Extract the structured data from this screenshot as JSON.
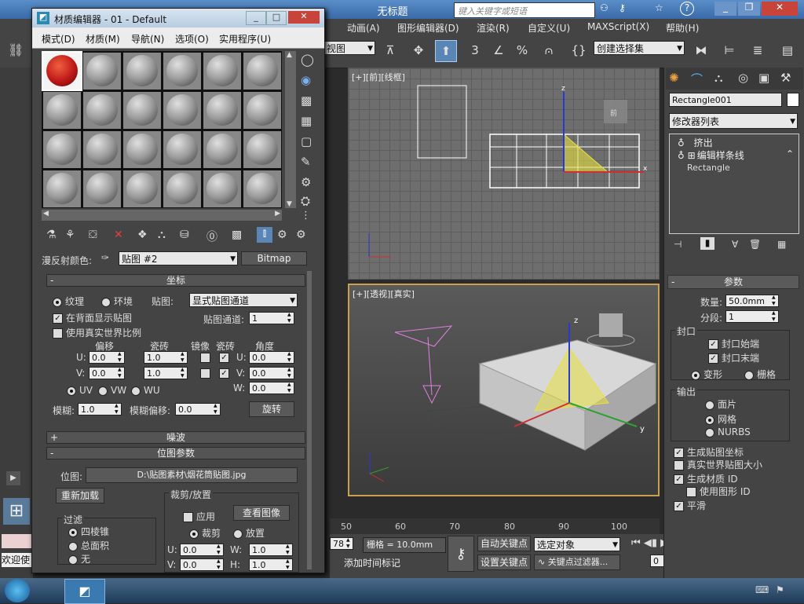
{
  "main": {
    "title": "无标题",
    "search_placeholder": "键入关键字或短语",
    "menu": [
      "动画(A)",
      "图形编辑器(D)",
      "渲染(R)",
      "自定义(U)",
      "MAXScript(X)",
      "帮助(H)"
    ],
    "view_dropdown": "视图",
    "selection_set_placeholder": "创建选择集",
    "vp_front_label": "[+][前][线框]",
    "vp_persp_label": "[+][透视][真实]",
    "ruler_ticks": [
      "50",
      "60",
      "70",
      "80",
      "90",
      "100"
    ],
    "frame_field": "78",
    "grid_status": "栅格 = 10.0mm",
    "auto_key": "自动关键点",
    "set_key": "设置关键点",
    "key_filter_select": "选定对象",
    "add_time_tag": "添加时间标记",
    "key_filters": "关键点过滤器...",
    "frame_current": "0",
    "welcome_text": "欢迎使"
  },
  "cmd": {
    "object_name": "Rectangle001",
    "modifier_list": "修改器列表",
    "stack": [
      "挤出",
      "编辑样条线",
      "Rectangle"
    ],
    "params_title": "参数",
    "amount_label": "数量:",
    "amount_value": "50.0mm",
    "segments_label": "分段:",
    "segments_value": "1",
    "capping_title": "封口",
    "cap_start": "封口始端",
    "cap_end": "封口末端",
    "morph": "变形",
    "grid": "栅格",
    "output_title": "输出",
    "out_patch": "面片",
    "out_mesh": "网格",
    "out_nurbs": "NURBS",
    "gen_mapping": "生成贴图坐标",
    "real_world": "真实世界贴图大小",
    "gen_mat_id": "生成材质 ID",
    "use_shape_id": "使用图形 ID",
    "smooth": "平滑"
  },
  "mat": {
    "title": "材质编辑器 - 01 - Default",
    "menu": [
      "模式(D)",
      "材质(M)",
      "导航(N)",
      "选项(O)",
      "实用程序(U)"
    ],
    "diffuse_label": "漫反射颜色:",
    "map_name": "贴图 #2",
    "map_type": "Bitmap",
    "coords_title": "坐标",
    "texture": "纹理",
    "environ": "环境",
    "mapping_label": "贴图:",
    "mapping_value": "显式贴图通道",
    "show_back": "在背面显示贴图",
    "map_channel_label": "贴图通道:",
    "map_channel_value": "1",
    "use_real_world": "使用真实世界比例",
    "col_offset": "偏移",
    "col_tiling": "瓷砖",
    "col_mirror": "镜像",
    "col_tile": "瓷砖",
    "col_angle": "角度",
    "u_label": "U:",
    "v_label": "V:",
    "w_label": "W:",
    "u_offset": "0.0",
    "v_offset": "0.0",
    "u_tiling": "1.0",
    "v_tiling": "1.0",
    "u_angle": "0.0",
    "v_angle": "0.0",
    "w_angle": "0.0",
    "uv": "UV",
    "vw": "VW",
    "wu": "WU",
    "blur_label": "模糊:",
    "blur_value": "1.0",
    "blur_offset_label": "模糊偏移:",
    "blur_offset_value": "0.0",
    "rotate_btn": "旋转",
    "noise_title": "噪波",
    "bitmap_params_title": "位图参数",
    "bitmap_label": "位图:",
    "bitmap_path": "D:\\贴图素材\\烟花筒贴图.jpg",
    "reload_btn": "重新加载",
    "crop_title": "裁剪/放置",
    "apply": "应用",
    "view_image": "查看图像",
    "crop": "裁剪",
    "place": "放置",
    "filter_title": "过滤",
    "f_pyramid": "四棱锥",
    "f_sat": "总面积",
    "f_none": "无",
    "crop_u": "0.0",
    "crop_v": "0.0",
    "crop_w": "1.0",
    "crop_h": "1.0",
    "h_label": "H:"
  },
  "colors": {
    "accent": "#c8a050",
    "selection_yellow": "#e8e040",
    "panel": "#444444"
  }
}
